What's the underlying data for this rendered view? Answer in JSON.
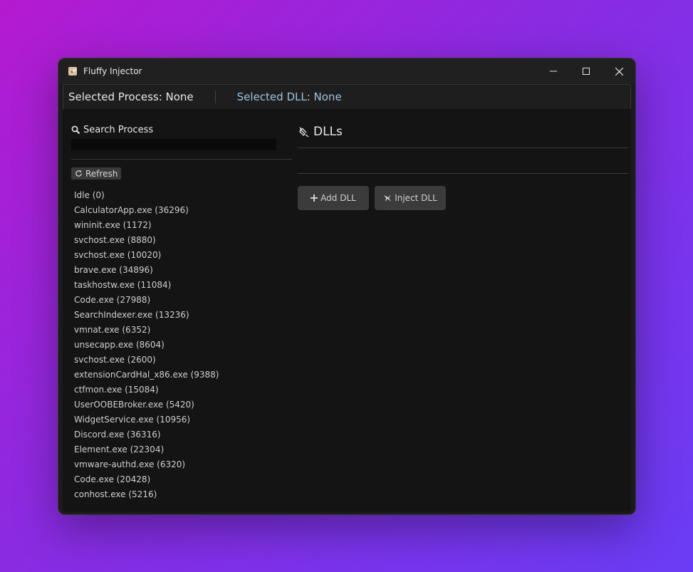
{
  "window": {
    "title": "Fluffy Injector"
  },
  "status": {
    "selected_process": "Selected Process: None",
    "selected_dll": "Selected DLL: None"
  },
  "left": {
    "search_label": "Search Process",
    "search_value": "",
    "refresh_label": "Refresh",
    "processes": [
      "Idle (0)",
      "CalculatorApp.exe (36296)",
      "wininit.exe (1172)",
      "svchost.exe (8880)",
      "svchost.exe (10020)",
      "brave.exe (34896)",
      "taskhostw.exe (11084)",
      "Code.exe (27988)",
      "SearchIndexer.exe (13236)",
      "vmnat.exe (6352)",
      "unsecapp.exe (8604)",
      "svchost.exe (2600)",
      "extensionCardHal_x86.exe (9388)",
      "ctfmon.exe (15084)",
      "UserOOBEBroker.exe (5420)",
      "WidgetService.exe (10956)",
      "Discord.exe (36316)",
      "Element.exe (22304)",
      "vmware-authd.exe (6320)",
      "Code.exe (20428)",
      "conhost.exe (5216)"
    ]
  },
  "right": {
    "header": "DLLs",
    "add_label": "Add DLL",
    "inject_label": "Inject DLL"
  },
  "colors": {
    "accent_dll": "#9fc3e0",
    "background_gradient": [
      "#b41ad0",
      "#6a3cf5"
    ]
  },
  "icons": {
    "app": "fluffy-app-icon",
    "search": "magnifier-icon",
    "refresh": "refresh-icon",
    "dll": "syringe-icon",
    "add": "plus-icon",
    "inject": "inject-icon"
  }
}
